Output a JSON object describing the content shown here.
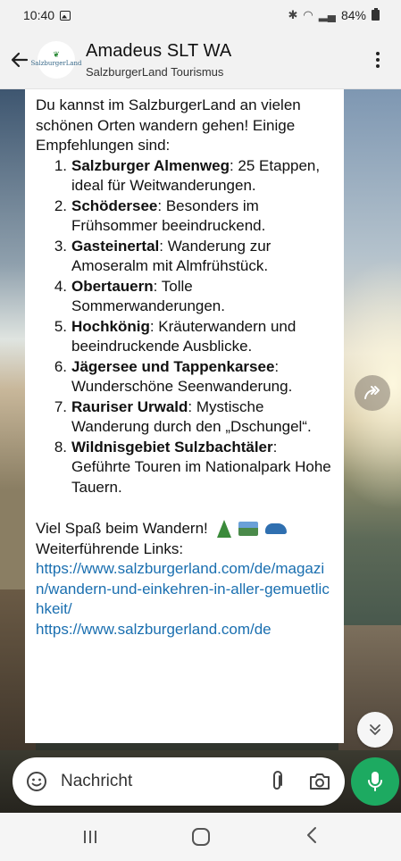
{
  "status_bar": {
    "time": "10:40",
    "battery": "84%"
  },
  "header": {
    "title": "Amadeus SLT WA",
    "subtitle": "SalzburgerLand Tourismus",
    "avatar_text": "SalzburgerLand"
  },
  "message": {
    "intro": "Du kannst im SalzburgerLand an vielen schönen Orten wandern gehen! Einige Empfehlungen sind:",
    "items": [
      {
        "num": "1.",
        "name": "Salzburger Almenweg",
        "desc": ": 25 Etappen, ideal für Weitwanderungen."
      },
      {
        "num": "2.",
        "name": "Schödersee",
        "desc": ": Besonders im Frühsommer beeindruckend."
      },
      {
        "num": "3.",
        "name": "Gasteinertal",
        "desc": ": Wanderung zur Amoseralm mit Almfrühstück."
      },
      {
        "num": "4.",
        "name": "Obertauern",
        "desc": ": Tolle Sommerwanderungen."
      },
      {
        "num": "5.",
        "name": "Hochkönig",
        "desc": ": Kräuterwandern und beeindruckende Ausblicke."
      },
      {
        "num": "6.",
        "name": "Jägersee und Tappenkarsee",
        "desc": ": Wunderschöne Seenwanderung."
      },
      {
        "num": "7.",
        "name": "Rauriser Urwald",
        "desc": ": Mystische Wanderung durch den „Dschungel“."
      },
      {
        "num": "8.",
        "name": "Wildnisgebiet Sulzbachtäler",
        "desc": ": Geführte Touren im Nationalpark Hohe Tauern."
      }
    ],
    "closing": "Viel Spaß beim Wandern!",
    "links_label": "Weiterführende Links:",
    "link1": "https://www.salzburgerland.com/de/magazin/wandern-und-einkehren-in-aller-gemuetlichkeit/",
    "link2": "https://www.salzburgerland.com/de"
  },
  "input": {
    "placeholder": "Nachricht"
  },
  "colors": {
    "accent_green": "#1daa61",
    "link_blue": "#1a6fb0"
  }
}
